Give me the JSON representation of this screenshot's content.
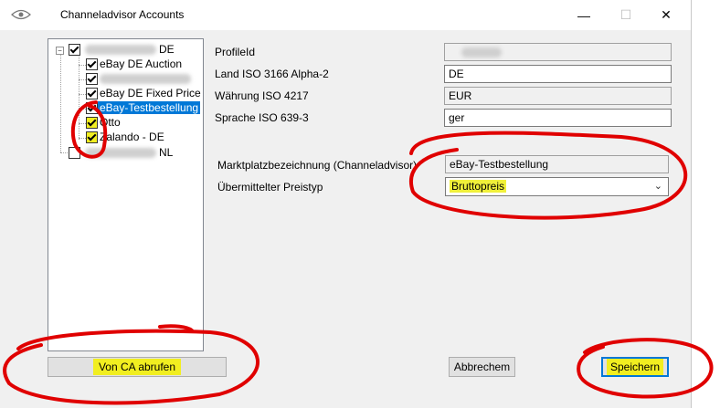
{
  "window": {
    "title": "Channeladvisor Accounts",
    "minimize_glyph": "—",
    "maximize_glyph": "☐",
    "close_glyph": "✕"
  },
  "tree": {
    "root_suffix": "DE",
    "items": [
      {
        "label": "eBay DE Auction",
        "checked": true
      },
      {
        "label": "",
        "checked": true
      },
      {
        "label": "eBay DE Fixed Price",
        "checked": true
      },
      {
        "label": "eBay-Testbestellung",
        "checked": true,
        "selected": true
      },
      {
        "label": "Otto",
        "checked": true
      },
      {
        "label": "Zalando - DE",
        "checked": true
      }
    ],
    "second_root_suffix": "NL"
  },
  "form": {
    "profile_id_label": "ProfileId",
    "profile_id_value": "",
    "country_label": "Land ISO 3166 Alpha-2",
    "country_value": "DE",
    "currency_label": "Währung ISO 4217",
    "currency_value": "EUR",
    "language_label": "Sprache ISO 639-3",
    "language_value": "ger",
    "marketplace_label": "Marktplatzbezeichnung (Channeladvisor)",
    "marketplace_value": "eBay-Testbestellung",
    "price_type_label": "Übermittelter Preistyp",
    "price_type_value": "Bruttopreis"
  },
  "buttons": {
    "fetch": "Von CA abrufen",
    "cancel": "Abbrechem",
    "save": "Speichern"
  },
  "colors": {
    "annotation_red": "#e00000",
    "highlight_yellow": "#f1ee20",
    "selection_blue": "#0078d7"
  }
}
